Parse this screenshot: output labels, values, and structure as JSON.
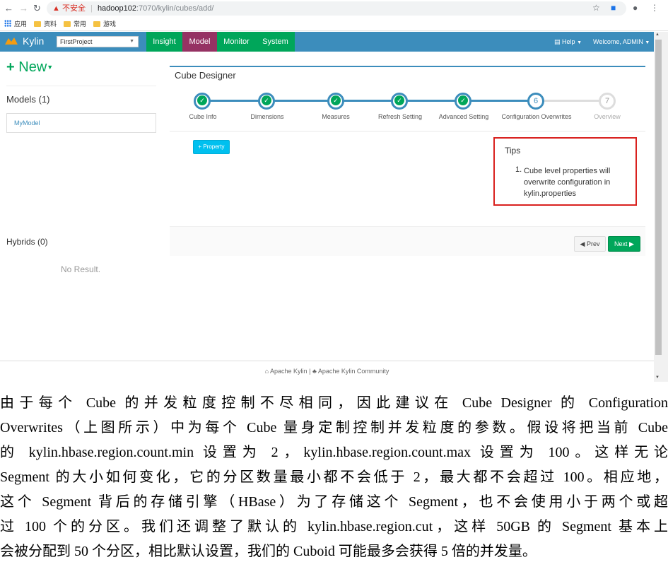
{
  "browser": {
    "url_warning": "不安全",
    "url_host": "hadoop102",
    "url_path": ":7070/kylin/cubes/add/",
    "bookmarks": [
      "应用",
      "资料",
      "常用",
      "游戏"
    ]
  },
  "navbar": {
    "brand": "Kylin",
    "project": "FirstProject",
    "tabs": [
      "Insight",
      "Model",
      "Monitor",
      "System"
    ],
    "help": "Help",
    "user": "Welcome, ADMIN"
  },
  "sidebar": {
    "new_label": "New",
    "models_title": "Models (1)",
    "models": [
      "MyModel"
    ],
    "hybrids_title": "Hybrids (0)",
    "no_result": "No Result."
  },
  "designer": {
    "title": "Cube Designer",
    "steps": [
      {
        "label": "Cube Info",
        "state": "done"
      },
      {
        "label": "Dimensions",
        "state": "done"
      },
      {
        "label": "Measures",
        "state": "done"
      },
      {
        "label": "Refresh Setting",
        "state": "done"
      },
      {
        "label": "Advanced Setting",
        "state": "done"
      },
      {
        "label": "Configuration Overwrites",
        "state": "current",
        "num": "6"
      },
      {
        "label": "Overview",
        "state": "todo",
        "num": "7"
      }
    ],
    "property_button": "+ Property",
    "tips_title": "Tips",
    "tips_num": "1.",
    "tips_text": "Cube level properties will overwrite configuration in kylin.properties",
    "prev_label": "Prev",
    "next_label": "Next"
  },
  "footer": {
    "left": "Apache Kylin",
    "sep": "|",
    "right": "Apache Kylin Community"
  },
  "document": {
    "lines": [
      "由于每个 Cube 的并发粒度控制不尽相同，因此建议在 Cube Designer 的 Configuration",
      "Overwrites（上图所示）中为每个 Cube 量身定制控制并发粒度的参数。假设将把当前 Cube",
      "的 kylin.hbase.region.count.min 设置为 2，kylin.hbase.region.count.max 设置为 100。这样无论",
      "Segment 的大小如何变化，它的分区数量最小都不会低于 2，最大都不会超过 100。相应地，",
      "这个 Segment 背后的存储引擎（HBase）为了存储这个 Segment，也不会使用小于两个或超",
      "过 100 个的分区。我们还调整了默认的 kylin.hbase.region.cut，这样 50GB 的 Segment 基本上",
      "会被分配到 50 个分区，相比默认设置，我们的 Cuboid 可能最多会获得 5 倍的并发量。"
    ]
  }
}
